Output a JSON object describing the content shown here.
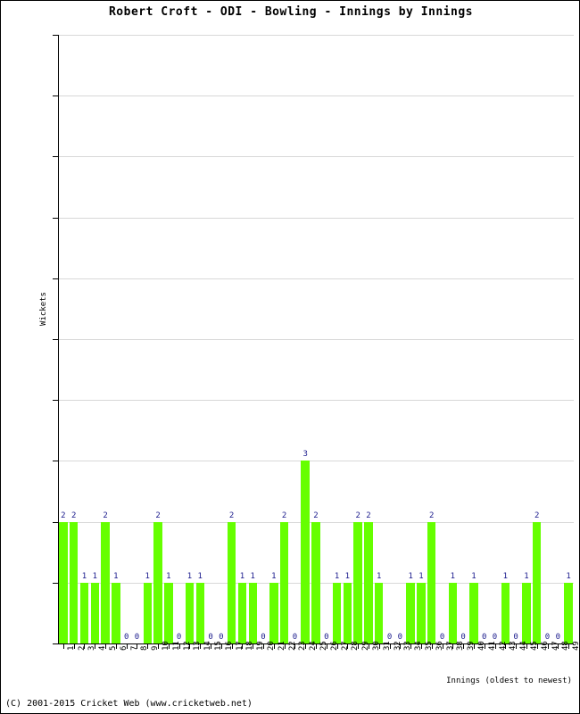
{
  "chart_data": {
    "type": "bar",
    "title": "Robert Croft - ODI - Bowling - Innings by Innings",
    "xlabel": "Innings (oldest to newest)",
    "ylabel": "Wickets",
    "ylim": [
      0,
      10
    ],
    "yticks": [
      0,
      1,
      2,
      3,
      4,
      5,
      6,
      7,
      8,
      9,
      10
    ],
    "grid": true,
    "legend": null,
    "bar_color": "#66ff00",
    "value_label_color": "#1a1a8c",
    "categories": [
      1,
      2,
      3,
      4,
      5,
      6,
      7,
      8,
      9,
      10,
      11,
      12,
      13,
      14,
      15,
      16,
      17,
      18,
      19,
      20,
      21,
      22,
      23,
      24,
      25,
      26,
      27,
      28,
      29,
      30,
      31,
      32,
      33,
      34,
      35,
      36,
      37,
      38,
      39,
      40,
      41,
      42,
      43,
      44,
      45,
      46,
      47,
      48,
      49
    ],
    "values": [
      2,
      2,
      1,
      1,
      2,
      1,
      0,
      0,
      1,
      2,
      1,
      0,
      1,
      1,
      0,
      0,
      2,
      1,
      1,
      0,
      1,
      2,
      0,
      3,
      2,
      0,
      1,
      1,
      2,
      2,
      1,
      0,
      0,
      1,
      1,
      2,
      0,
      1,
      0,
      1,
      0,
      0,
      1,
      0,
      1,
      2,
      0,
      0,
      1
    ]
  },
  "footer": {
    "copyright": "(C) 2001-2015 Cricket Web (www.cricketweb.net)"
  }
}
